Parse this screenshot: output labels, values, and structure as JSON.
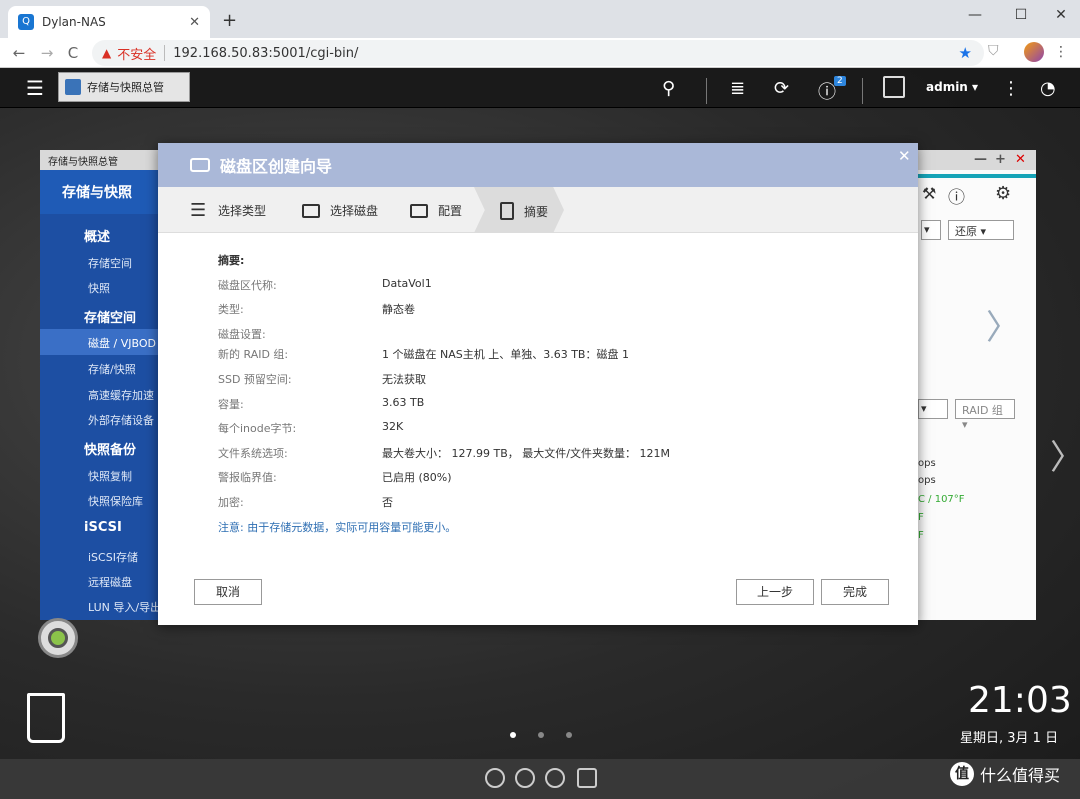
{
  "browser": {
    "tab_title": "Dylan-NAS",
    "tab_favicon": "Q",
    "tab_close": "✕",
    "new_tab": "+",
    "win_min": "—",
    "win_max": "☐",
    "win_close": "✕",
    "back": "←",
    "forward": "→",
    "reload": "C",
    "insecure_label": "不安全",
    "url": "192.168.50.83:5001/cgi-bin/",
    "star": "★",
    "menu": "⋮"
  },
  "qts": {
    "menu_icon": "☰",
    "taskbar_tab": "存储与快照总管",
    "notification_count": "2",
    "user": "admin ▾",
    "more": "⋮",
    "search": "⚲",
    "tasks": "≣",
    "sync": "⟳",
    "info": "ⓘ",
    "meter": "◔"
  },
  "bg_window": {
    "title": "存储与快照总管",
    "header": "存储与快照",
    "sections": [
      {
        "label": "概述",
        "items": [
          "存储空间",
          "快照"
        ]
      },
      {
        "label": "存储空间",
        "items": [
          "磁盘 / VJBOD",
          "存储/快照",
          "高速缓存加速",
          "外部存储设备"
        ]
      },
      {
        "label": "快照备份",
        "items": [
          "快照复制",
          "快照保险库"
        ]
      },
      {
        "label": "iSCSI",
        "items": [
          "iSCSI存储",
          "远程磁盘",
          "LUN 导入/导出"
        ]
      }
    ],
    "restore_btn": "还原",
    "raid_btn": "RAID 组",
    "frag1": "ops",
    "frag2": "C / 107°F",
    "frag3": "ops",
    "frag4": "F",
    "frag5": "F"
  },
  "dialog": {
    "title": "磁盘区创建向导",
    "close": "✕",
    "steps": [
      "选择类型",
      "选择磁盘",
      "配置",
      "摘要"
    ],
    "summary_title": "摘要:",
    "rows": [
      {
        "label": "磁盘区代称:",
        "value": "DataVol1"
      },
      {
        "label": "类型:",
        "value": "静态卷"
      },
      {
        "label": "磁盘设置:",
        "value": ""
      },
      {
        "label": "新的 RAID 组:",
        "value": "1 个磁盘在 NAS主机 上、单独、3.63 TB：磁盘 1"
      },
      {
        "label": "SSD 预留空间:",
        "value": "无法获取"
      },
      {
        "label": "容量:",
        "value": "3.63 TB"
      },
      {
        "label": "每个inode字节:",
        "value": "32K"
      },
      {
        "label": "文件系统选项:",
        "value": "最大卷大小：  127.99 TB，  最大文件/文件夹数量：  121M"
      },
      {
        "label": "警报临界值:",
        "value": "已启用 (80%)"
      },
      {
        "label": "加密:",
        "value": "否"
      }
    ],
    "note": "注意: 由于存储元数据，实际可用容量可能更小。",
    "cancel": "取消",
    "prev": "上一步",
    "finish": "完成"
  },
  "desktop": {
    "time": "21:03",
    "date": "星期日, 3月 1 日",
    "watermark": "什么值得买",
    "watermark_logo": "值"
  }
}
